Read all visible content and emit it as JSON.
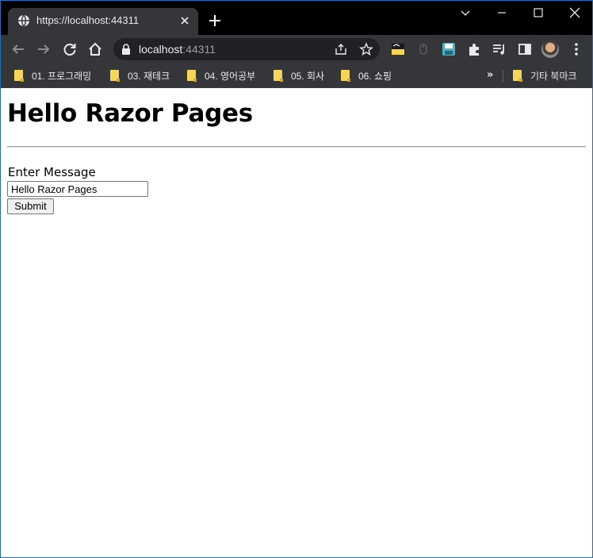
{
  "browser": {
    "tab": {
      "title": "https://localhost:44311"
    },
    "address": {
      "host": "localhost",
      "port": ":44311"
    },
    "bookmarks": [
      {
        "label": "01. 프로그래밍"
      },
      {
        "label": "03. 재테크"
      },
      {
        "label": "04. 영어공부"
      },
      {
        "label": "05. 회사"
      },
      {
        "label": "06. 쇼핑"
      }
    ],
    "bookmarks_overflow": "»",
    "other_bookmarks": "기타 북마크",
    "colors": {
      "frame": "#000000",
      "toolbar": "#35363a",
      "omnibox": "#202124",
      "folder": "#f5d65b"
    }
  },
  "page": {
    "heading": "Hello Razor Pages",
    "form": {
      "label": "Enter Message",
      "input_value": "Hello Razor Pages",
      "submit_label": "Submit"
    }
  }
}
